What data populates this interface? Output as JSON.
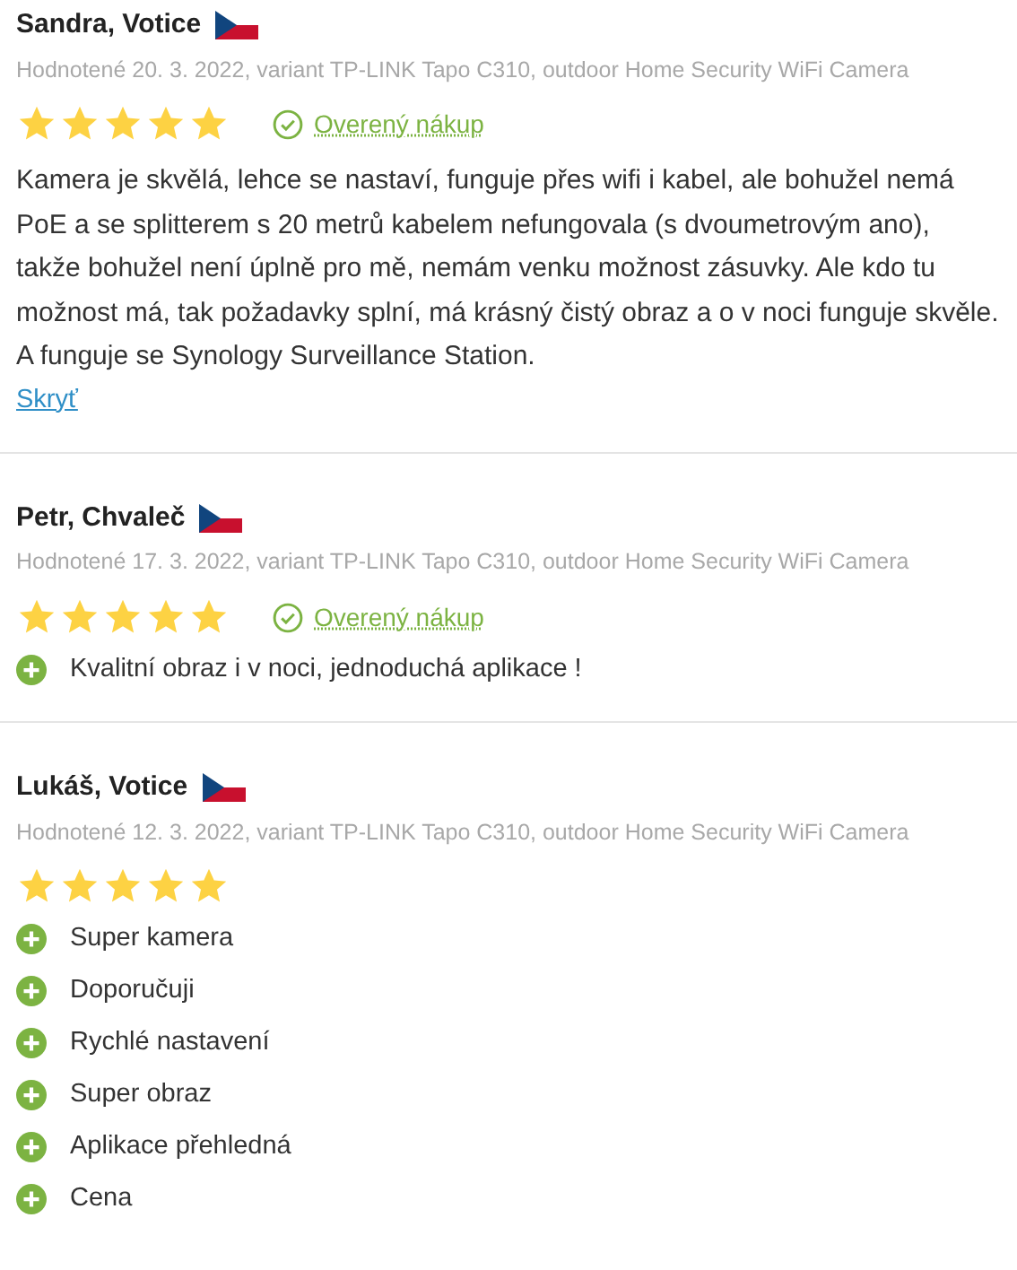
{
  "reviews": [
    {
      "author": "Sandra, Votice",
      "meta": "Hodnotené 20. 3. 2022, variant TP-LINK Tapo C310, outdoor Home Security WiFi Camera",
      "stars": 5,
      "verified": true,
      "verified_label": "Overený nákup",
      "text": "Kamera je skvělá, lehce se nastaví, funguje přes wifi i kabel, ale bohužel nemá PoE a se splitterem s 20 metrů kabelem nefungovala (s dvoumetrovým ano), takže bohužel není úplně pro mě, nemám venku možnost zásuvky. Ale kdo tu možnost má, tak požadavky splní, má krásný čistý obraz a o v noci funguje skvěle. A funguje se Synology Surveillance Station.",
      "toggle_link": "Skryť"
    },
    {
      "author": "Petr, Chvaleč",
      "meta": "Hodnotené 17. 3. 2022, variant TP-LINK Tapo C310, outdoor Home Security WiFi Camera",
      "stars": 5,
      "verified": true,
      "verified_label": "Overený nákup",
      "pros": [
        "Kvalitní obraz i v noci, jednoduchá aplikace !"
      ]
    },
    {
      "author": "Lukáš, Votice",
      "meta": "Hodnotené 12. 3. 2022, variant TP-LINK Tapo C310, outdoor Home Security WiFi Camera",
      "stars": 5,
      "verified": false,
      "pros": [
        "Super kamera",
        "Doporučuji",
        "Rychlé nastavení",
        "Super obraz",
        "Aplikace přehledná",
        "Cena"
      ]
    }
  ]
}
